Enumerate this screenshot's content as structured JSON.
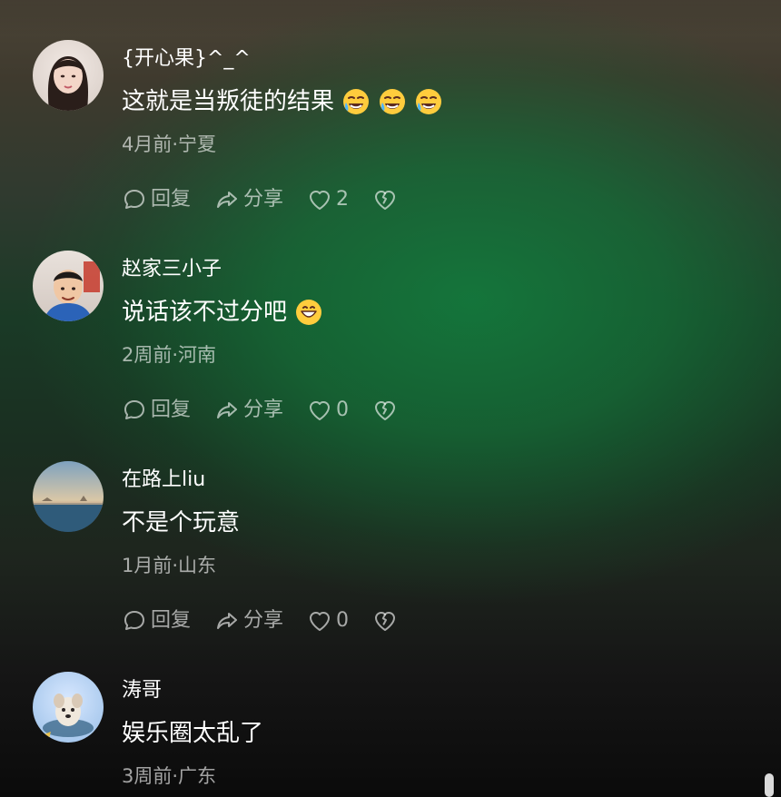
{
  "comments": [
    {
      "username": "{开心果}^_^",
      "text": "这就是当叛徒的结果",
      "emoji_icons": [
        "rolling-on-floor-laughing-icon",
        "rolling-on-floor-laughing-icon",
        "rolling-on-floor-laughing-icon"
      ],
      "meta": "4月前·宁夏",
      "reply_label": "回复",
      "share_label": "分享",
      "like_count": "2"
    },
    {
      "username": "赵家三小子",
      "text": "说话该不过分吧",
      "emoji_icons": [
        "grinning-face-icon"
      ],
      "meta": "2周前·河南",
      "reply_label": "回复",
      "share_label": "分享",
      "like_count": "0"
    },
    {
      "username": "在路上liu",
      "text": "不是个玩意",
      "emoji_icons": [],
      "meta": "1月前·山东",
      "reply_label": "回复",
      "share_label": "分享",
      "like_count": "0"
    },
    {
      "username": "涛哥",
      "text": "娱乐圈太乱了",
      "emoji_icons": [],
      "meta": "3周前·广东"
    }
  ],
  "colors": {
    "text_primary": "#ffffff",
    "text_secondary": "#a8b0a8",
    "background_green": "#157a3c",
    "background_dark": "#0b0b0b"
  },
  "icons": {
    "reply": "comment-bubble-icon",
    "share": "share-arrow-icon",
    "like": "heart-outline-icon",
    "dislike": "broken-heart-icon"
  }
}
